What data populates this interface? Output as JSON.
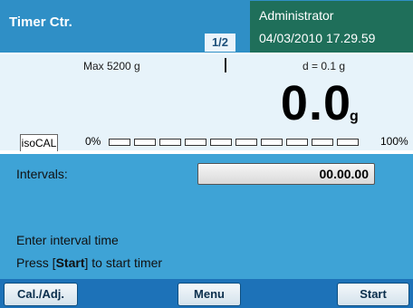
{
  "header": {
    "title": "Timer Ctr.",
    "page_indicator": "1/2",
    "user": "Administrator",
    "datetime": "04/03/2010 17.29.59"
  },
  "weighing": {
    "max_label": "Max 5200 g",
    "d_label": "d = 0.1 g",
    "value": "0.0",
    "unit": "g",
    "isocal_label": "isoCAL",
    "bar_min": "0%",
    "bar_max": "100%",
    "bar_fill": 0
  },
  "form": {
    "intervals_label": "Intervals:",
    "intervals_value": "00.00.00",
    "message_1": "Enter interval time",
    "message_2_prefix": "Press [",
    "message_2_key": "Start",
    "message_2_suffix": "] to start timer"
  },
  "footer": {
    "cal_button": "Cal./Adj.",
    "menu_button": "Menu",
    "start_button": "Start"
  },
  "colors": {
    "header_bg": "#2f8fc6",
    "user_bg": "#1f6f5a",
    "weigh_bg": "#e7f3fa",
    "form_bg": "#3ea3d6",
    "footer_bg": "#1d72b8"
  }
}
